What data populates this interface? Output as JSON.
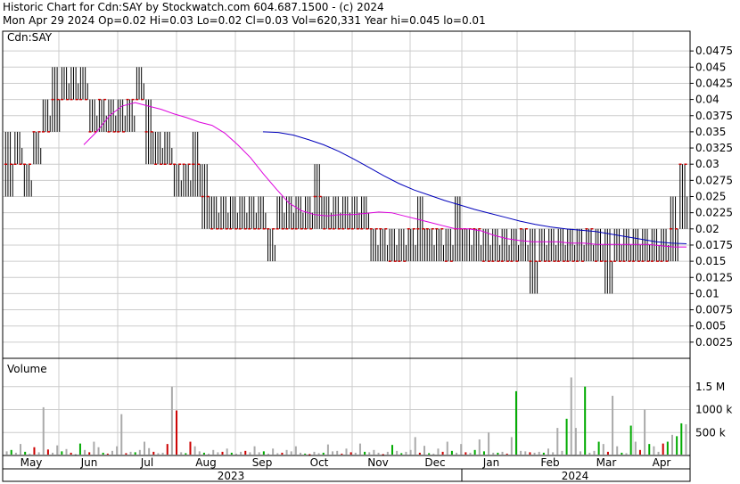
{
  "header": {
    "line1": "Historic Chart for Cdn:SAY by Stockwatch.com 604.687.1500 - (c) 2024",
    "line2": "Mon Apr 29 2024   Op=0.02  Hi=0.03  Lo=0.02  Cl=0.03  Vol=620,331  Year hi=0.045  lo=0.01"
  },
  "colors": {
    "background": "#ffffff",
    "grid": "#cccccc",
    "frame": "#000000",
    "bar_price": "#000000",
    "dash": "#cc0000",
    "ma_short": "#dd00dd",
    "ma_long": "#0000bb",
    "vol_up": "#00aa00",
    "vol_down": "#cc0000",
    "vol_flat": "#aaaaaa"
  },
  "chart_data": [
    {
      "type": "ohlc",
      "label": "Cdn:SAY",
      "ylim": [
        0,
        0.05
      ],
      "y_ticks": [
        "0.0475",
        "0.045",
        "0.0425",
        "0.04",
        "0.0375",
        "0.035",
        "0.0325",
        "0.03",
        "0.0275",
        "0.025",
        "0.0225",
        "0.02",
        "0.0175",
        "0.015",
        "0.0125",
        "0.01",
        "0.0075",
        "0.005",
        "0.0025"
      ],
      "x_months": [
        "May",
        "Jun",
        "Jul",
        "Aug",
        "Sep",
        "Oct",
        "Nov",
        "Dec",
        "Jan",
        "Feb",
        "Mar",
        "Apr"
      ],
      "x_years": [
        "2023",
        "2024"
      ],
      "segments": [
        [
          0.025,
          0.035,
          0.03
        ],
        [
          0.03,
          0.035,
          0.03
        ],
        [
          0.025,
          0.03,
          0.03
        ],
        [
          0.03,
          0.035,
          0.035
        ],
        [
          0.035,
          0.04,
          0.035
        ],
        [
          0.035,
          0.045,
          0.04
        ],
        [
          0.04,
          0.045,
          0.04
        ],
        [
          0.04,
          0.045,
          0.04
        ],
        [
          0.04,
          0.045,
          0.04
        ],
        [
          0.035,
          0.04,
          0.035
        ],
        [
          0.035,
          0.04,
          0.04
        ],
        [
          0.035,
          0.04,
          0.035
        ],
        [
          0.035,
          0.04,
          0.035
        ],
        [
          0.035,
          0.04,
          0.04
        ],
        [
          0.04,
          0.045,
          0.04
        ],
        [
          0.03,
          0.04,
          0.035
        ],
        [
          0.03,
          0.035,
          0.03
        ],
        [
          0.03,
          0.035,
          0.03
        ],
        [
          0.025,
          0.03,
          0.03
        ],
        [
          0.025,
          0.03,
          0.03
        ],
        [
          0.025,
          0.035,
          0.03
        ],
        [
          0.02,
          0.03,
          0.025
        ],
        [
          0.02,
          0.025,
          0.02
        ],
        [
          0.02,
          0.025,
          0.02
        ],
        [
          0.02,
          0.025,
          0.02
        ],
        [
          0.02,
          0.025,
          0.02
        ],
        [
          0.02,
          0.025,
          0.02
        ],
        [
          0.02,
          0.025,
          0.02
        ],
        [
          0.015,
          0.02,
          0.02
        ],
        [
          0.02,
          0.025,
          0.02
        ],
        [
          0.02,
          0.025,
          0.02
        ],
        [
          0.02,
          0.025,
          0.02
        ],
        [
          0.02,
          0.025,
          0.02
        ],
        [
          0.02,
          0.03,
          0.025
        ],
        [
          0.02,
          0.025,
          0.02
        ],
        [
          0.02,
          0.025,
          0.02
        ],
        [
          0.02,
          0.025,
          0.02
        ],
        [
          0.02,
          0.025,
          0.02
        ],
        [
          0.02,
          0.025,
          0.02
        ],
        [
          0.015,
          0.02,
          0.02
        ],
        [
          0.015,
          0.02,
          0.02
        ],
        [
          0.015,
          0.02,
          0.015
        ],
        [
          0.015,
          0.02,
          0.015
        ],
        [
          0.015,
          0.02,
          0.02
        ],
        [
          0.015,
          0.025,
          0.02
        ],
        [
          0.015,
          0.02,
          0.02
        ],
        [
          0.015,
          0.02,
          0.02
        ],
        [
          0.015,
          0.02,
          0.015
        ],
        [
          0.015,
          0.025,
          0.02
        ],
        [
          0.015,
          0.02,
          0.02
        ],
        [
          0.015,
          0.02,
          0.02
        ],
        [
          0.015,
          0.02,
          0.015
        ],
        [
          0.015,
          0.02,
          0.015
        ],
        [
          0.015,
          0.02,
          0.015
        ],
        [
          0.015,
          0.02,
          0.015
        ],
        [
          0.015,
          0.02,
          0.02
        ],
        [
          0.01,
          0.02,
          0.015
        ],
        [
          0.015,
          0.02,
          0.015
        ],
        [
          0.015,
          0.02,
          0.015
        ],
        [
          0.015,
          0.02,
          0.015
        ],
        [
          0.015,
          0.02,
          0.015
        ],
        [
          0.015,
          0.02,
          0.015
        ],
        [
          0.015,
          0.02,
          0.02
        ],
        [
          0.015,
          0.02,
          0.015
        ],
        [
          0.01,
          0.02,
          0.015
        ],
        [
          0.015,
          0.02,
          0.015
        ],
        [
          0.015,
          0.02,
          0.015
        ],
        [
          0.015,
          0.02,
          0.015
        ],
        [
          0.015,
          0.02,
          0.015
        ],
        [
          0.015,
          0.02,
          0.015
        ],
        [
          0.015,
          0.02,
          0.015
        ],
        [
          0.015,
          0.025,
          0.02
        ],
        [
          0.02,
          0.03,
          0.03
        ]
      ],
      "ma_short": [
        0.033,
        0.035,
        0.0375,
        0.039,
        0.0395,
        0.039,
        0.0385,
        0.0378,
        0.0372,
        0.0365,
        0.036,
        0.0348,
        0.033,
        0.031,
        0.0285,
        0.0262,
        0.024,
        0.0228,
        0.0222,
        0.022,
        0.0222,
        0.0222,
        0.0224,
        0.0226,
        0.0225,
        0.022,
        0.0215,
        0.021,
        0.0205,
        0.02,
        0.02,
        0.0197,
        0.019,
        0.0185,
        0.0182,
        0.018,
        0.018,
        0.018,
        0.0178,
        0.0178,
        0.0176,
        0.0176,
        0.0176,
        0.0176,
        0.0176,
        0.0174,
        0.0172,
        0.0172
      ],
      "ma_long": [
        0.035,
        0.0349,
        0.0345,
        0.0338,
        0.033,
        0.032,
        0.0308,
        0.0295,
        0.0282,
        0.027,
        0.026,
        0.0252,
        0.0244,
        0.0237,
        0.023,
        0.0224,
        0.0218,
        0.0212,
        0.0207,
        0.0203,
        0.02,
        0.0198,
        0.0196,
        0.0192,
        0.0188,
        0.0184,
        0.018,
        0.0178,
        0.0177
      ]
    },
    {
      "type": "bar",
      "label": "Volume",
      "y_ticks": [
        "1.5 M",
        "1000 k",
        "500 k"
      ],
      "ylim": [
        0,
        2000000
      ],
      "values": [
        90000,
        120000,
        60000,
        250000,
        80000,
        40000,
        180000,
        70000,
        1050000,
        130000,
        60000,
        220000,
        90000,
        140000,
        60000,
        30000,
        260000,
        120000,
        70000,
        300000,
        180000,
        60000,
        40000,
        100000,
        200000,
        900000,
        50000,
        80000,
        70000,
        120000,
        300000,
        160000,
        80000,
        50000,
        60000,
        250000,
        1500000,
        980000,
        70000,
        50000,
        300000,
        200000,
        90000,
        60000,
        40000,
        120000,
        70000,
        80000,
        150000,
        60000,
        40000,
        80000,
        100000,
        70000,
        200000,
        70000,
        90000,
        40000,
        150000,
        50000,
        60000,
        120000,
        90000,
        200000,
        60000,
        40000,
        30000,
        80000,
        50000,
        60000,
        240000,
        90000,
        100000,
        40000,
        150000,
        70000,
        60000,
        260000,
        80000,
        70000,
        120000,
        60000,
        30000,
        80000,
        230000,
        100000,
        50000,
        80000,
        120000,
        400000,
        60000,
        210000,
        50000,
        40000,
        150000,
        80000,
        300000,
        100000,
        60000,
        250000,
        70000,
        60000,
        120000,
        350000,
        90000,
        500000,
        60000,
        60000,
        80000,
        40000,
        400000,
        1400000,
        100000,
        90000,
        70000,
        60000,
        80000,
        60000,
        150000,
        70000,
        600000,
        100000,
        800000,
        1700000,
        600000,
        90000,
        1500000,
        60000,
        100000,
        300000,
        250000,
        80000,
        1300000,
        200000,
        60000,
        50000,
        650000,
        300000,
        120000,
        1000000,
        250000,
        200000,
        80000,
        260000,
        300000,
        450000,
        420000,
        700000,
        680000
      ],
      "colors": [
        "flat",
        "up",
        "flat",
        "flat",
        "up",
        "flat",
        "down",
        "flat",
        "flat",
        "down",
        "flat",
        "flat",
        "up",
        "flat",
        "down",
        "flat",
        "up",
        "flat",
        "down",
        "flat",
        "flat",
        "up",
        "down",
        "flat",
        "flat",
        "flat",
        "down",
        "flat",
        "up",
        "flat",
        "flat",
        "flat",
        "down",
        "flat",
        "flat",
        "down",
        "flat",
        "down",
        "flat",
        "up",
        "down",
        "flat",
        "flat",
        "up",
        "flat",
        "flat",
        "flat",
        "down",
        "flat",
        "up",
        "flat",
        "flat",
        "down",
        "flat",
        "flat",
        "flat",
        "up",
        "flat",
        "flat",
        "flat",
        "down",
        "flat",
        "flat",
        "flat",
        "flat",
        "up",
        "down",
        "flat",
        "flat",
        "up",
        "flat",
        "flat",
        "flat",
        "down",
        "flat",
        "down",
        "flat",
        "flat",
        "up",
        "flat",
        "flat",
        "flat",
        "down",
        "flat",
        "up",
        "flat",
        "up",
        "flat",
        "flat",
        "flat",
        "down",
        "flat",
        "up",
        "flat",
        "flat",
        "down",
        "flat",
        "up",
        "flat",
        "flat",
        "down",
        "flat",
        "up",
        "flat",
        "up",
        "flat",
        "flat",
        "up",
        "flat",
        "down",
        "flat",
        "up",
        "flat",
        "flat",
        "down",
        "flat",
        "flat",
        "up",
        "flat",
        "flat",
        "flat",
        "flat",
        "up",
        "flat",
        "flat",
        "flat",
        "up",
        "flat",
        "flat",
        "up",
        "flat",
        "down",
        "flat",
        "flat",
        "up",
        "flat",
        "up",
        "flat",
        "down",
        "flat",
        "up",
        "flat",
        "flat",
        "down",
        "up",
        "flat",
        "up",
        "up",
        "flat"
      ]
    }
  ]
}
